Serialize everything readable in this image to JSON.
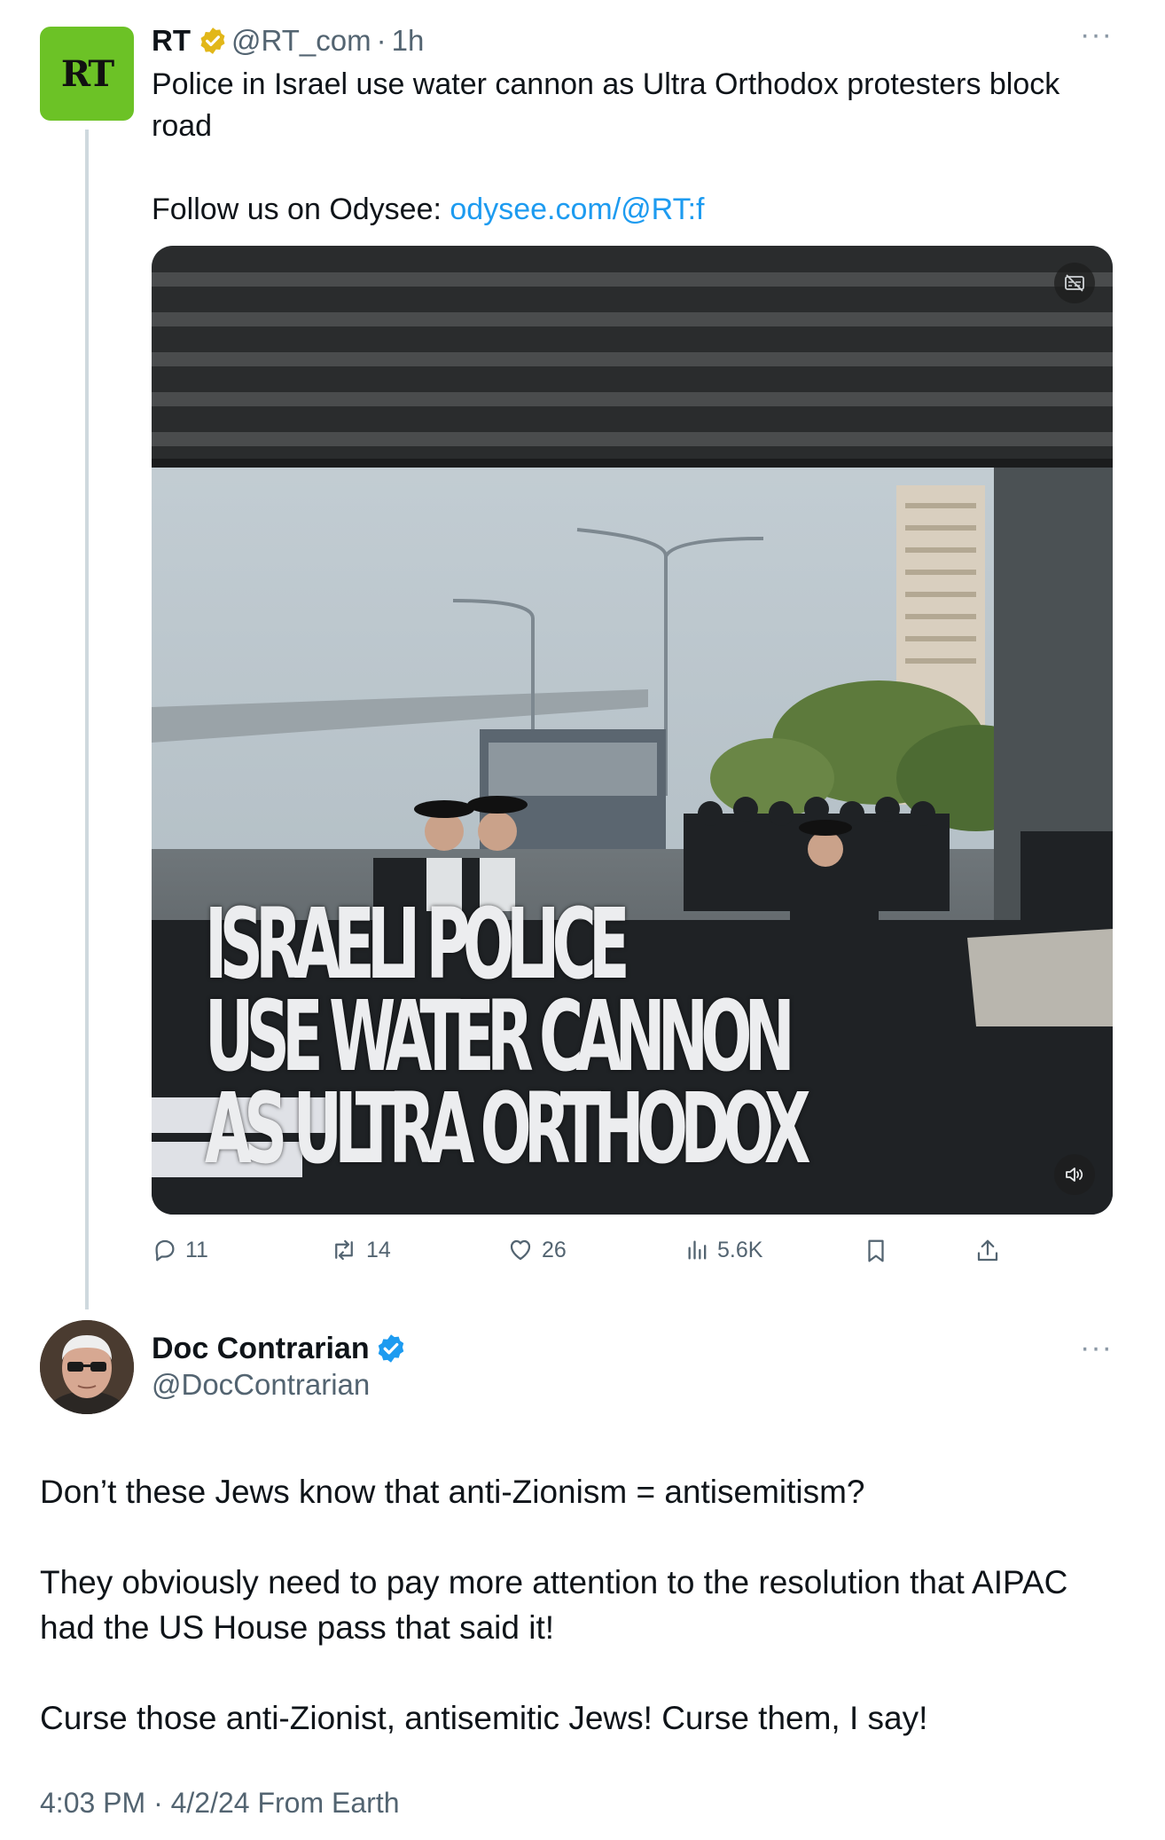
{
  "parent_tweet": {
    "avatar_text": "RT",
    "name": "RT",
    "handle": "@RT_com",
    "time": "1h",
    "more": "···",
    "text_line1": "Police in Israel use water cannon as Ultra Orthodox protesters block road",
    "follow_prefix": "Follow us on Odysee: ",
    "follow_link": "odysee.com/@RT:f",
    "video": {
      "caption_lines": [
        "ISRAELI POLICE",
        "USE WATER CANNON",
        "AS ULTRA ORTHODOX"
      ],
      "top_icon": "captions-off-icon",
      "bottom_icon": "volume-icon"
    },
    "actions": {
      "replies": "11",
      "reposts": "14",
      "likes": "26",
      "views": "5.6K"
    },
    "badge_color": "#e2b719"
  },
  "reply_tweet": {
    "name": "Doc Contrarian",
    "handle": "@DocContrarian",
    "more": "···",
    "paragraphs": [
      "Don’t these Jews know that anti-Zionism = antisemitism?",
      "They obviously need to pay more attention to the resolution that AIPAC had the US House pass that said it!",
      "Curse those anti-Zionist, antisemitic Jews! Curse them, I say!"
    ],
    "meta": "4:03 PM · 4/2/24 From Earth",
    "badge_color": "#1d9bf0"
  }
}
